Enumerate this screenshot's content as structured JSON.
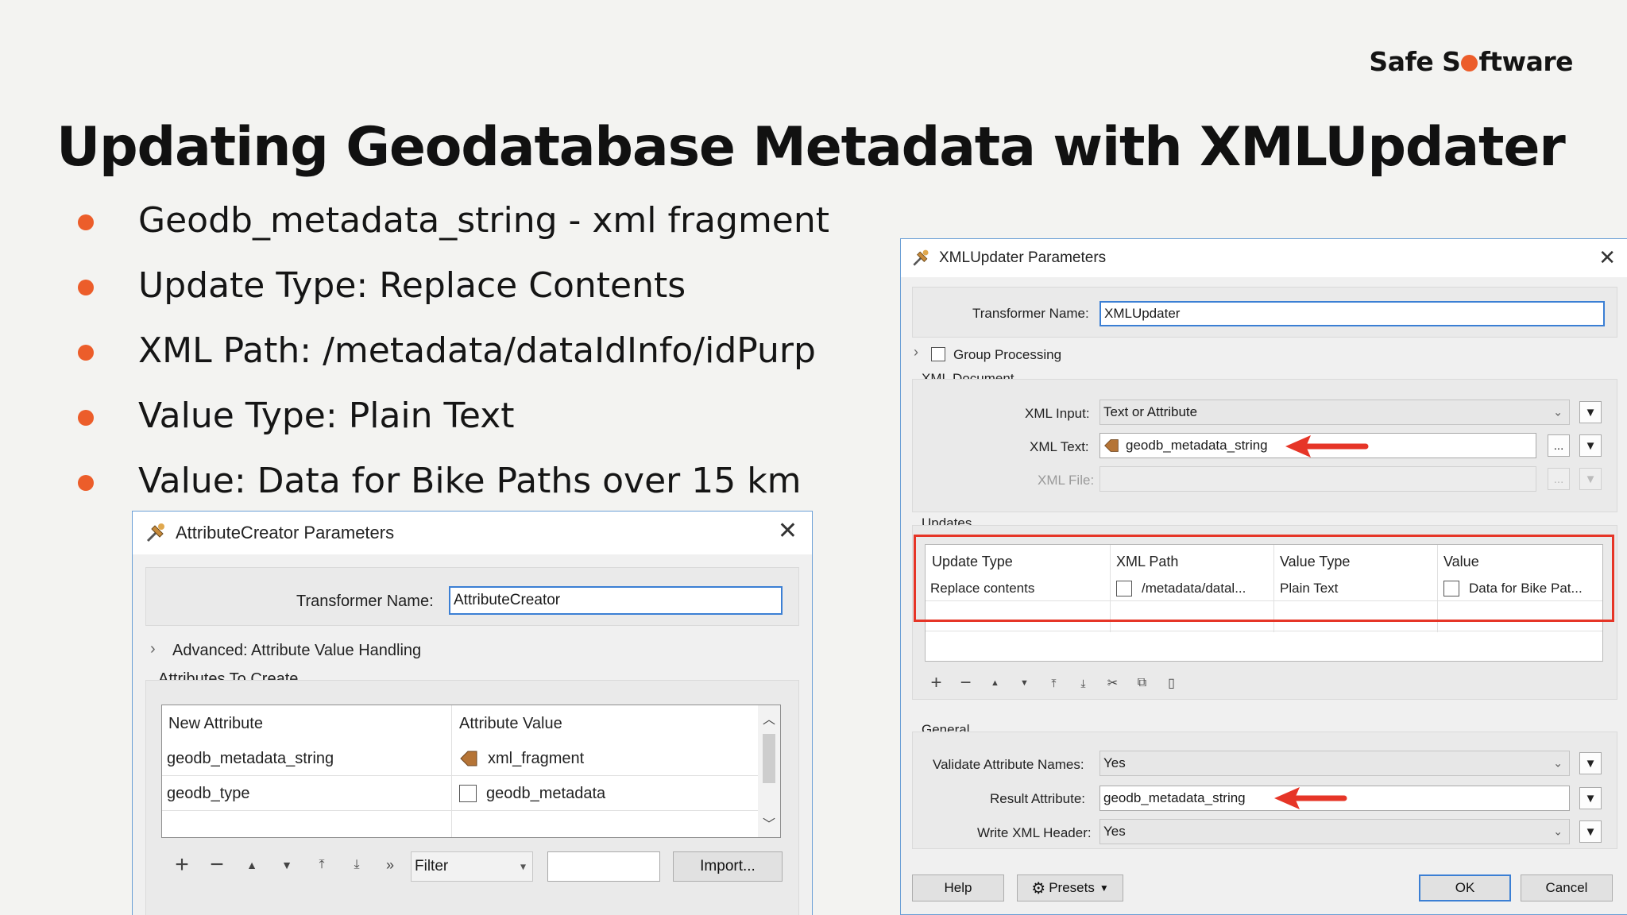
{
  "brand": {
    "pre": "Safe S",
    "post": "ftware"
  },
  "slide": {
    "title": "Updating Geodatabase Metadata with XMLUpdater",
    "bullets": [
      "Geodb_metadata_string - xml fragment",
      "Update Type: Replace Contents",
      "XML Path: /metadata/dataIdInfo/idPurp",
      "Value Type: Plain Text",
      "Value: Data for Bike Paths over 15 km"
    ]
  },
  "colors": {
    "accent": "#ec5d2a",
    "highlight": "#e63527",
    "focus": "#3b7fd4"
  },
  "attr_dialog": {
    "title": "AttributeCreator Parameters",
    "transformer_label": "Transformer Name:",
    "transformer_value": "AttributeCreator",
    "advanced": "Advanced: Attribute Value Handling",
    "section": "Attributes To Create",
    "columns": [
      "New Attribute",
      "Attribute Value"
    ],
    "rows": [
      {
        "name": "geodb_metadata_string",
        "value": "xml_fragment",
        "icon": "attribute-icon"
      },
      {
        "name": "geodb_type",
        "value": "geodb_metadata",
        "icon": "text-value-icon"
      }
    ],
    "filter_value": "Filter",
    "filter_text": "",
    "import_label": "Import..."
  },
  "xml_dialog": {
    "title": "XMLUpdater Parameters",
    "transformer_label": "Transformer Name:",
    "transformer_value": "XMLUpdater",
    "group_processing": "Group Processing",
    "section_document": "XML Document",
    "xml_input_label": "XML Input:",
    "xml_input_value": "Text or Attribute",
    "xml_text_label": "XML Text:",
    "xml_text_value": "geodb_metadata_string",
    "xml_file_label": "XML File:",
    "ellipsis": "...",
    "section_updates": "Updates",
    "update_columns": [
      "Update Type",
      "XML Path",
      "Value Type",
      "Value"
    ],
    "update_row": {
      "type": "Replace contents",
      "path": "/metadata/datal...",
      "value_type": "Plain Text",
      "value": "Data for Bike Pat..."
    },
    "section_general": "General",
    "validate_label": "Validate Attribute Names:",
    "validate_value": "Yes",
    "result_label": "Result Attribute:",
    "result_value": "geodb_metadata_string",
    "header_label": "Write XML Header:",
    "header_value": "Yes",
    "help_label": "Help",
    "presets_label": "Presets",
    "ok_label": "OK",
    "cancel_label": "Cancel"
  }
}
